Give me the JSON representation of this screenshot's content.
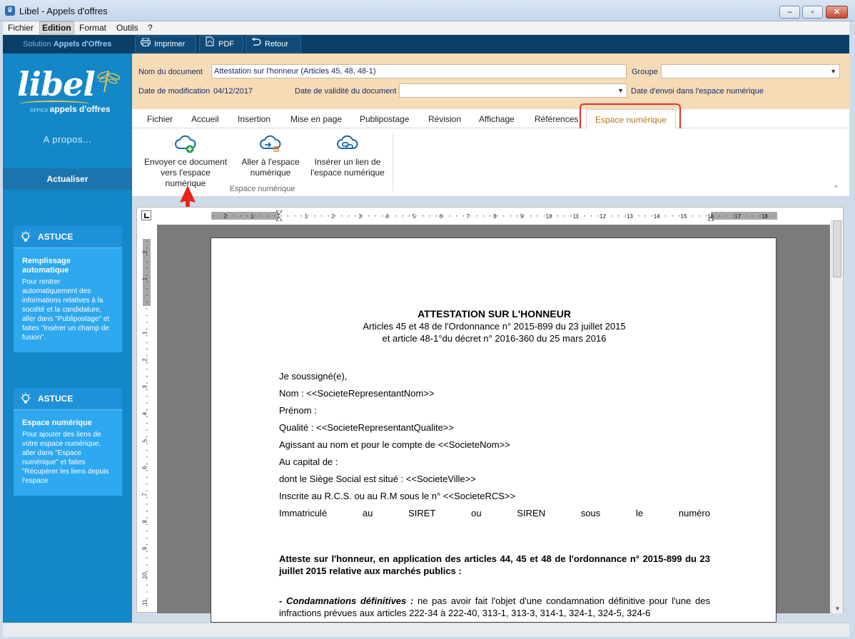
{
  "window": {
    "title": "Libel - Appels d'offres"
  },
  "menu": [
    "Fichier",
    "Edition",
    "Format",
    "Outils",
    "?"
  ],
  "toolbar": {
    "solution_prefix": "Solution",
    "solution_name": "Appels d'Offres",
    "buttons": [
      {
        "label": "Imprimer",
        "icon": "printer-icon"
      },
      {
        "label": "PDF",
        "icon": "pdf-icon"
      },
      {
        "label": "Retour",
        "icon": "back-arrow-icon"
      }
    ]
  },
  "sidebar": {
    "logo_word": "libel",
    "logo_tag_small": "OFFICE",
    "logo_tag": "appels d'offres",
    "apropos": "A propos...",
    "actualiser": "Actualiser",
    "tips": [
      {
        "heading": "ASTUCE",
        "title": "Remplissage automatique",
        "body": "Pour rentrer automatiquement des informations relatives à la société et la candidature, aller dans \"Publipostage\" et faites \"Insérer un champ de fusion\"."
      },
      {
        "heading": "ASTUCE",
        "title": "Espace numérique",
        "body": "Pour ajouter des liens de votre espace numérique, aller dans \"Espace numérique\" et faites \"Récupérer les liens depuis l'espace"
      }
    ]
  },
  "form": {
    "nom_label": "Nom du document",
    "nom_value": "Attestation sur l'honneur (Articles 45, 48, 48-1)",
    "groupe_label": "Groupe",
    "groupe_value": "",
    "modif_label": "Date de modification",
    "modif_value": "04/12/2017",
    "validite_label": "Date de validité du document",
    "validite_value": "",
    "envoi_label": "Date d'envoi dans l'espace numérique"
  },
  "ribbon": {
    "tabs": [
      "Fichier",
      "Accueil",
      "Insertion",
      "Mise en page",
      "Publipostage",
      "Révision",
      "Affichage",
      "Références",
      "Espace numérique"
    ],
    "active_tab": "Espace numérique",
    "buttons": [
      {
        "line1": "Envoyer ce document",
        "line2": "vers l'espace numérique"
      },
      {
        "line1": "Aller à l'espace",
        "line2": "numérique"
      },
      {
        "line1": "Insérer un lien de",
        "line2": "l'espace numérique"
      }
    ],
    "group_label": "Espace numérique"
  },
  "ruler": {
    "h_labels": [
      "2",
      "1",
      "1",
      "2",
      "3",
      "4",
      "5",
      "6",
      "7",
      "8",
      "9",
      "10",
      "11",
      "12",
      "13",
      "14",
      "15",
      "16",
      "17",
      "18"
    ],
    "v_labels": [
      "2",
      "1",
      "1",
      "2",
      "3",
      "4",
      "5",
      "6",
      "7",
      "8",
      "9",
      "10",
      "11"
    ]
  },
  "document": {
    "title": "ATTESTATION SUR L'HONNEUR",
    "subtitle1": "Articles 45 et 48 de l'Ordonnance n° 2015-899 du 23 juillet 2015",
    "subtitle2": "et article 48-1°du décret n° 2016-360 du 25 mars 2016",
    "lines": [
      "Je soussigné(e),",
      "Nom : <<SocieteRepresentantNom>>",
      "Prénom :",
      "Qualité : <<SocieteRepresentantQualite>>",
      "Agissant au nom et pour le compte de <<SocieteNom>>",
      "Au capital de :",
      "dont le Siège Social est situé : <<SocieteVille>>",
      "Inscrite au R.C.S. ou au R.M sous le n° <<SocieteRCS>>"
    ],
    "immat_words": [
      "Immatriculé",
      "au",
      "SIRET",
      "ou",
      "SIREN",
      "sous",
      "le",
      "numéro"
    ],
    "atteste": "Atteste sur l'honneur, en application des articles 44, 45 et 48 de l'ordonnance n° 2015-899 du 23 juillet 2015 relative aux marchés publics :",
    "condamnations_label": "- Condamnations définitives :",
    "condamnations_text": " ne pas avoir fait l'objet d'une condamnation définitive pour l'une des infractions prévues aux articles 222-34 à 222-40, 313-1, 313-3, 314-1, 324-1, 324-5, 324-6"
  },
  "colors": {
    "sidebar": "#1387c8",
    "toolbar": "#0b3f68",
    "form_bg": "#f5dcb7",
    "active_tab": "#b2781e",
    "highlight": "#e6312a"
  }
}
